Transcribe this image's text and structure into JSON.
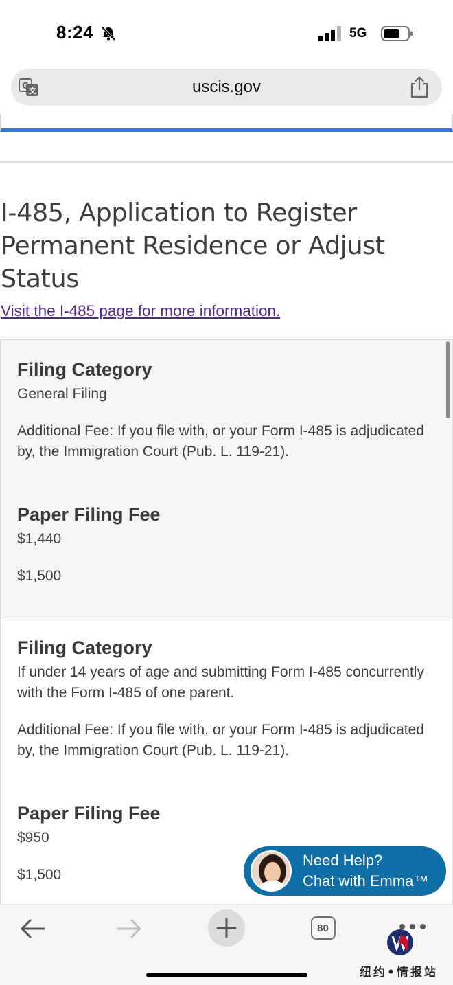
{
  "status_bar": {
    "time": "8:24",
    "network": "5G"
  },
  "browser": {
    "url": "uscis.gov",
    "tab_count": "80"
  },
  "page": {
    "title": "I-485, Application to Register Permanent Residence or Adjust Status",
    "link_text": "Visit the I-485 page for more information."
  },
  "cards": [
    {
      "category_heading": "Filing Category",
      "category_value": "General Filing",
      "additional_fee": "Additional Fee: If you file with, or your Form I-485 is adjudicated by, the Immigration Court (Pub. L. 119-21).",
      "fee_heading": "Paper Filing Fee",
      "fee_value": "$1,440",
      "additional_fee_value": "$1,500"
    },
    {
      "category_heading": "Filing Category",
      "category_value": "If under 14 years of age and submitting Form I-485 concurrently with the Form I-485 of one parent.",
      "additional_fee": "Additional Fee: If you file with, or your Form I-485 is adjudicated by, the Immigration Court (Pub. L. 119-21).",
      "fee_heading": "Paper Filing Fee",
      "fee_value": "$950",
      "additional_fee_value": "$1,500"
    }
  ],
  "chat": {
    "line1": "Need Help?",
    "line2": "Chat with Emma™"
  },
  "watermark": {
    "text": "纽约•情报站"
  },
  "colors": {
    "link": "#54278f",
    "accent_blue": "#2a7ae2",
    "chat_bg": "#0f6ea5",
    "card_bg": "#f5f5f5"
  }
}
